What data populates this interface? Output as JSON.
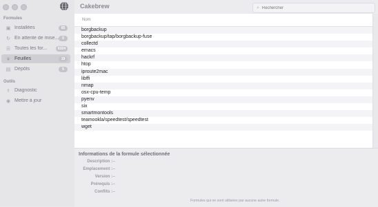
{
  "window": {
    "title": "Cakebrew"
  },
  "search": {
    "placeholder": "Rechercher"
  },
  "sidebar": {
    "sections": [
      {
        "title": "Formules"
      },
      {
        "title": "Outils"
      }
    ],
    "formules": [
      {
        "label": "Installées",
        "badge": "65",
        "icon": "package-icon"
      },
      {
        "label": "En attente de mise...",
        "badge": "0",
        "icon": "refresh-icon"
      },
      {
        "label": "Toutes les for...",
        "badge": "6324",
        "icon": "list-icon"
      },
      {
        "label": "Feuilles",
        "badge": "19",
        "icon": "leaf-icon"
      },
      {
        "label": "Dépôts",
        "badge": "5",
        "icon": "repository-icon"
      }
    ],
    "outils": [
      {
        "label": "Diagnostic",
        "icon": "stethoscope-icon"
      },
      {
        "label": "Mettre à jour",
        "icon": "update-icon"
      }
    ]
  },
  "table": {
    "column_header": "Nom",
    "rows": [
      "borgbackup",
      "borgbackup/tap/borgbackup-fuse",
      "collectd",
      "emacs",
      "hackrf",
      "htop",
      "iproute2mac",
      "libffi",
      "nmap",
      "osx-cpu-temp",
      "pyenv",
      "six",
      "smartmontools",
      "teamookla/speedtest/speedtest",
      "wget"
    ]
  },
  "info": {
    "title": "Informations de la formule sélectionnée",
    "fields": [
      {
        "label": "Description :",
        "value": "--"
      },
      {
        "label": "Emplacement :",
        "value": "--"
      },
      {
        "label": "Version :",
        "value": "--"
      },
      {
        "label": "Prérequis :",
        "value": "--"
      },
      {
        "label": "Conflits :",
        "value": "--"
      }
    ]
  },
  "footer": {
    "text": "Formules qui ne sont utilisées par aucune autre formule."
  },
  "colors": {
    "accent": "#cfcfd3",
    "badge": "#c3c3c8"
  }
}
